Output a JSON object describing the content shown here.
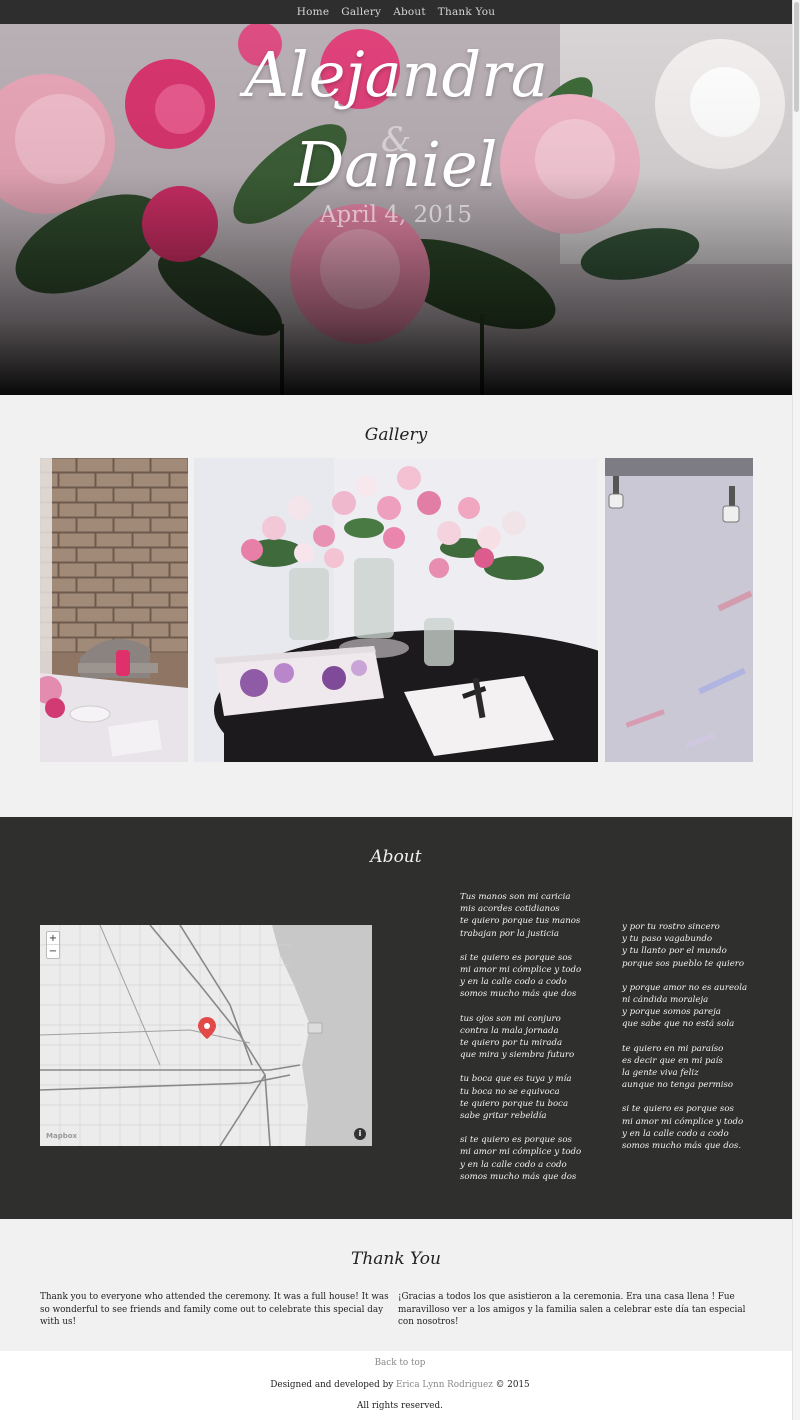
{
  "nav": {
    "items": [
      "Home",
      "Gallery",
      "About",
      "Thank You"
    ]
  },
  "hero": {
    "name1": "Alejandra",
    "amp": "&",
    "name2": "Daniel",
    "date": "April 4, 2015"
  },
  "gallery": {
    "title": "Gallery",
    "images": [
      "brick-wall-table-photo",
      "roses-guestbook-photo",
      "gallery-lights-photo"
    ]
  },
  "about": {
    "title": "About",
    "map": {
      "zoom_in": "+",
      "zoom_out": "−",
      "attribution": "Mapbox",
      "info": "i"
    },
    "poem_col1": [
      [
        "Tus manos son mi caricia",
        "mis acordes cotidianos",
        "te quiero porque tus manos",
        "trabajan por la justicia"
      ],
      [
        "si te quiero es porque sos",
        "mi amor mi cómplice y todo",
        "y en la calle codo a codo",
        "somos mucho más que dos"
      ],
      [
        "tus ojos son mi conjuro",
        "contra la mala jornada",
        "te quiero por tu mirada",
        "que mira y siembra futuro"
      ],
      [
        "tu boca que es tuya y mía",
        "tu boca no se equivoca",
        "te quiero porque tu boca",
        "sabe gritar rebeldía"
      ],
      [
        "si te quiero es porque sos",
        "mi amor mi cómplice y todo",
        "y en la calle codo a codo",
        "somos mucho más que dos"
      ]
    ],
    "poem_col2": [
      [
        "y por tu rostro sincero",
        "y tu paso vagabundo",
        "y tu llanto por el mundo",
        "porque sos pueblo te quiero"
      ],
      [
        "y porque amor no es aureola",
        "ni cándida moraleja",
        "y porque somos pareja",
        "que sabe que no está sola"
      ],
      [
        "te quiero en mi paraíso",
        "es decir que en mi país",
        "la gente viva feliz",
        "aunque no tenga permiso"
      ],
      [
        "si te quiero es porque sos",
        "mi amor mi cómplice y todo",
        "y en la calle codo a codo",
        "somos mucho más que dos."
      ]
    ]
  },
  "thanks": {
    "title": "Thank You",
    "english": "Thank you to everyone who attended the ceremony. It was a full house! It was so wonderful to see friends and family come out to celebrate this special day with us!",
    "spanish": "¡Gracias a todos los que asistieron a la ceremonia. Era una casa llena ! Fue maravilloso ver a los amigos y la familia salen a celebrar este día tan especial con nosotros!"
  },
  "footer": {
    "back_to_top": "Back to top",
    "credit_prefix": "Designed and developed by ",
    "credit_name": "Erica Lynn Rodriguez",
    "credit_suffix": " © 2015",
    "rights": "All rights reserved."
  },
  "colors": {
    "nav_bg": "#2e2e2e",
    "about_bg": "#2f302e",
    "page_bg": "#f1f1f1",
    "map_pin": "#e24a4a"
  }
}
